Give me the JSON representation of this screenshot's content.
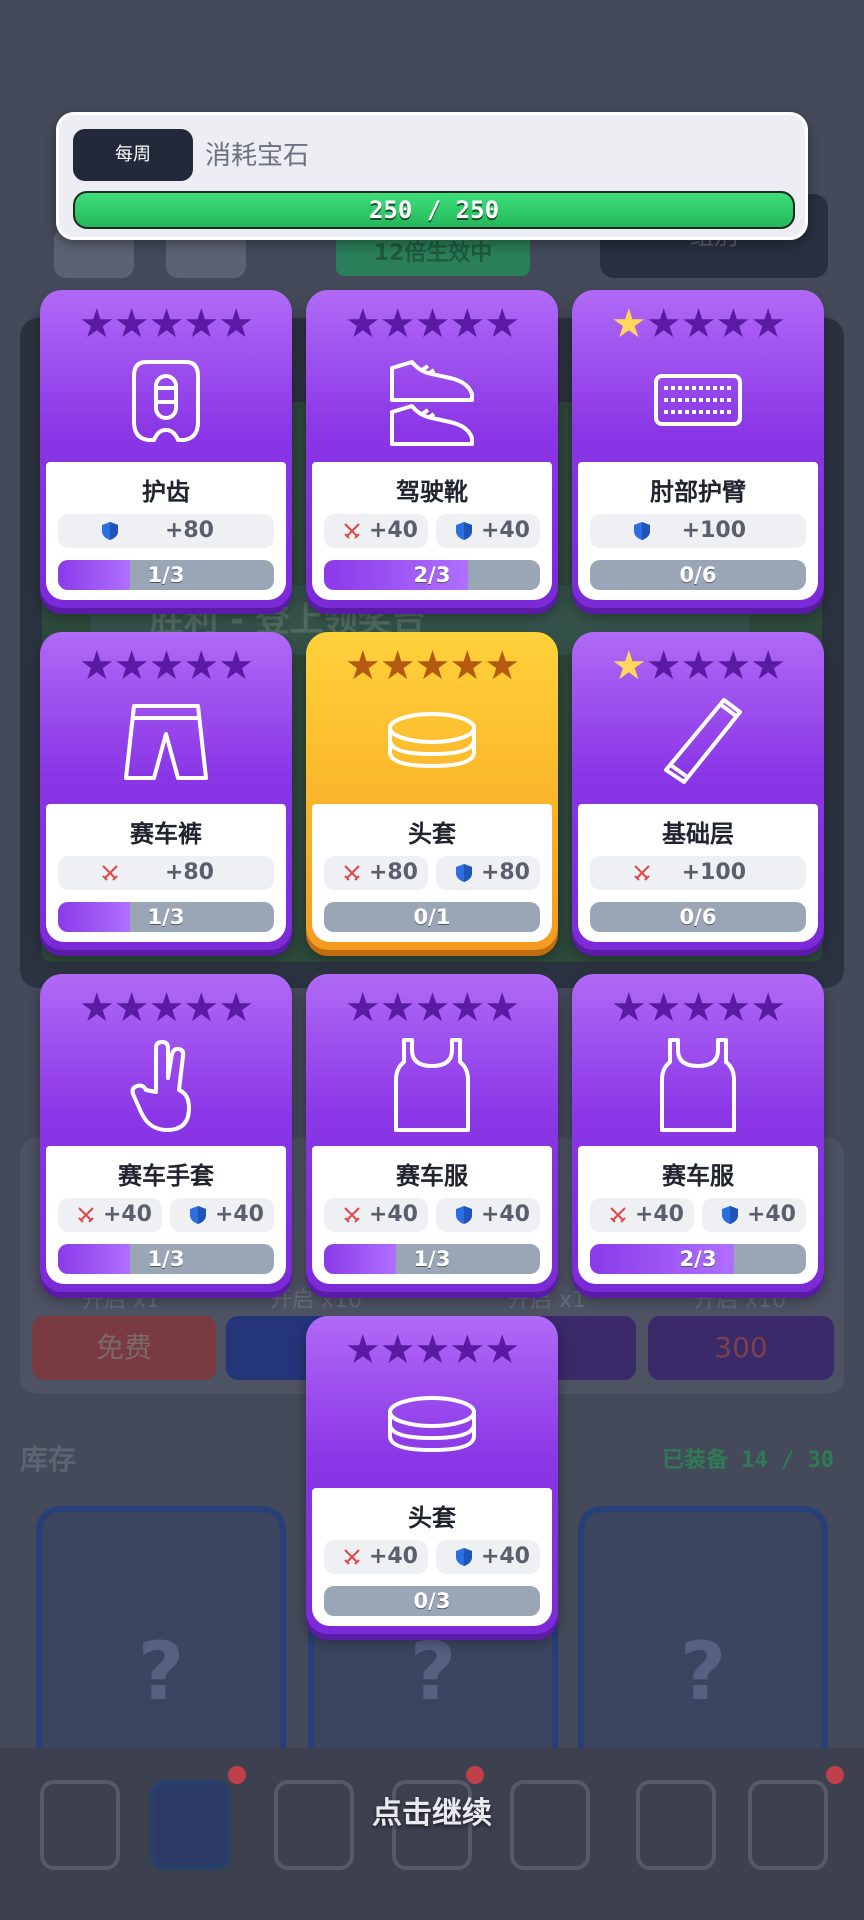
{
  "quest": {
    "tag": "每周",
    "label": "消耗宝石",
    "progress_text": "250 / 250",
    "progress": 1.0
  },
  "background": {
    "multiplier_tag": "12倍生效中",
    "dark_button": "组別",
    "banner": "胜利 - 登上领奖台",
    "free_button": "免费",
    "gem_price": "300",
    "open_x1": "开启 x1",
    "open_x10": "开启 x10",
    "inventory_title": "库存",
    "equipped_count": "已装备 14 / 30",
    "unknown_slot": "?"
  },
  "cards": [
    {
      "name": "护齿",
      "icon": "mouthguard-icon",
      "rarity_stars": 0,
      "gold": false,
      "stats": [
        {
          "type": "shield",
          "value": "+80"
        }
      ],
      "progress_text": "1/3",
      "progress": 0.333
    },
    {
      "name": "驾驶靴",
      "icon": "shoes-icon",
      "rarity_stars": 0,
      "gold": false,
      "stats": [
        {
          "type": "sword",
          "value": "+40"
        },
        {
          "type": "shield",
          "value": "+40"
        }
      ],
      "progress_text": "2/3",
      "progress": 0.667
    },
    {
      "name": "肘部护臂",
      "icon": "elbow-guard-icon",
      "rarity_stars": 1,
      "gold": false,
      "stats": [
        {
          "type": "shield",
          "value": "+100"
        }
      ],
      "progress_text": "0/6",
      "progress": 0
    },
    {
      "name": "赛车裤",
      "icon": "shorts-icon",
      "rarity_stars": 0,
      "gold": false,
      "stats": [
        {
          "type": "sword",
          "value": "+80"
        }
      ],
      "progress_text": "1/3",
      "progress": 0.333
    },
    {
      "name": "头套",
      "icon": "headband-icon",
      "rarity_stars": 0,
      "gold": true,
      "stats": [
        {
          "type": "sword",
          "value": "+80"
        },
        {
          "type": "shield",
          "value": "+80"
        }
      ],
      "progress_text": "0/1",
      "progress": 0
    },
    {
      "name": "基础层",
      "icon": "sleeve-icon",
      "rarity_stars": 1,
      "gold": false,
      "stats": [
        {
          "type": "sword",
          "value": "+100"
        }
      ],
      "progress_text": "0/6",
      "progress": 0
    },
    {
      "name": "赛车手套",
      "icon": "glove-icon",
      "rarity_stars": 0,
      "gold": false,
      "stats": [
        {
          "type": "sword",
          "value": "+40"
        },
        {
          "type": "shield",
          "value": "+40"
        }
      ],
      "progress_text": "1/3",
      "progress": 0.333
    },
    {
      "name": "赛车服",
      "icon": "tank-top-icon",
      "rarity_stars": 0,
      "gold": false,
      "stats": [
        {
          "type": "sword",
          "value": "+40"
        },
        {
          "type": "shield",
          "value": "+40"
        }
      ],
      "progress_text": "1/3",
      "progress": 0.333
    },
    {
      "name": "赛车服",
      "icon": "tank-top-icon",
      "rarity_stars": 0,
      "gold": false,
      "stats": [
        {
          "type": "sword",
          "value": "+40"
        },
        {
          "type": "shield",
          "value": "+40"
        }
      ],
      "progress_text": "2/3",
      "progress": 0.667
    },
    {
      "name": "头套",
      "icon": "headband-icon",
      "rarity_stars": 0,
      "gold": false,
      "stats": [
        {
          "type": "sword",
          "value": "+40"
        },
        {
          "type": "shield",
          "value": "+40"
        }
      ],
      "progress_text": "0/3",
      "progress": 0
    }
  ],
  "continue_hint": "点击继续",
  "colors": {
    "card_purple": "#8a36e6",
    "card_gold": "#fbb42a",
    "progress_green": "#2fcf6a",
    "sword_red": "#e04848",
    "shield_blue": "#2d6fe0"
  }
}
